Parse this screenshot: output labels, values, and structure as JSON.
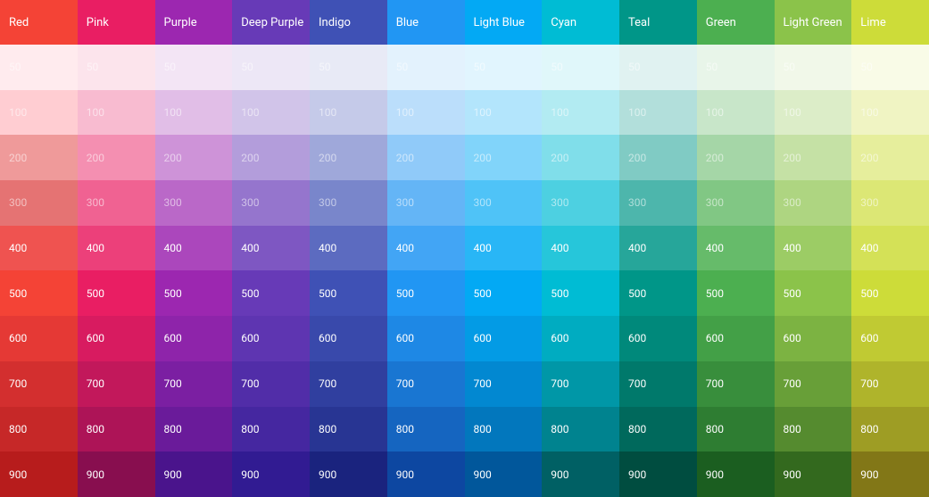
{
  "columns": [
    {
      "name": "Red",
      "header_bg": "#F44336",
      "shades": {
        "50": "#FFEBEE",
        "100": "#FFCDD2",
        "200": "#EF9A9A",
        "300": "#E57373",
        "400": "#EF5350",
        "500": "#F44336",
        "600": "#E53935",
        "700": "#D32F2F",
        "800": "#C62828",
        "900": "#B71C1C"
      }
    },
    {
      "name": "Pink",
      "header_bg": "#E91E63",
      "shades": {
        "50": "#FCE4EC",
        "100": "#F8BBD0",
        "200": "#F48FB1",
        "300": "#F06292",
        "400": "#EC407A",
        "500": "#E91E63",
        "600": "#D81B60",
        "700": "#C2185B",
        "800": "#AD1457",
        "900": "#880E4F"
      }
    },
    {
      "name": "Purple",
      "header_bg": "#9C27B0",
      "shades": {
        "50": "#F3E5F5",
        "100": "#E1BEE7",
        "200": "#CE93D8",
        "300": "#BA68C8",
        "400": "#AB47BC",
        "500": "#9C27B0",
        "600": "#8E24AA",
        "700": "#7B1FA2",
        "800": "#6A1B9A",
        "900": "#4A148C"
      }
    },
    {
      "name": "Deep Purple",
      "header_bg": "#673AB7",
      "shades": {
        "50": "#EDE7F6",
        "100": "#D1C4E9",
        "200": "#B39DDB",
        "300": "#9575CD",
        "400": "#7E57C2",
        "500": "#673AB7",
        "600": "#5E35B1",
        "700": "#512DA8",
        "800": "#4527A0",
        "900": "#311B92"
      }
    },
    {
      "name": "Indigo",
      "header_bg": "#3F51B5",
      "shades": {
        "50": "#E8EAF6",
        "100": "#C5CAE9",
        "200": "#9FA8DA",
        "300": "#7986CB",
        "400": "#5C6BC0",
        "500": "#3F51B5",
        "600": "#3949AB",
        "700": "#303F9F",
        "800": "#283593",
        "900": "#1A237E"
      }
    },
    {
      "name": "Blue",
      "header_bg": "#2196F3",
      "shades": {
        "50": "#E3F2FD",
        "100": "#BBDEFB",
        "200": "#90CAF9",
        "300": "#64B5F6",
        "400": "#42A5F5",
        "500": "#2196F3",
        "600": "#1E88E5",
        "700": "#1976D2",
        "800": "#1565C0",
        "900": "#0D47A1"
      }
    },
    {
      "name": "Light Blue",
      "header_bg": "#03A9F4",
      "shades": {
        "50": "#E1F5FE",
        "100": "#B3E5FC",
        "200": "#81D4FA",
        "300": "#4FC3F7",
        "400": "#29B6F6",
        "500": "#03A9F4",
        "600": "#039BE5",
        "700": "#0288D1",
        "800": "#0277BD",
        "900": "#01579B"
      }
    },
    {
      "name": "Cyan",
      "header_bg": "#00BCD4",
      "shades": {
        "50": "#E0F7FA",
        "100": "#B2EBF2",
        "200": "#80DEEA",
        "300": "#4DD0E1",
        "400": "#26C6DA",
        "500": "#00BCD4",
        "600": "#00ACC1",
        "700": "#0097A7",
        "800": "#00838F",
        "900": "#006064"
      }
    },
    {
      "name": "Teal",
      "header_bg": "#009688",
      "shades": {
        "50": "#E0F2F1",
        "100": "#B2DFDB",
        "200": "#80CBC4",
        "300": "#4DB6AC",
        "400": "#26A69A",
        "500": "#009688",
        "600": "#00897B",
        "700": "#00796B",
        "800": "#00695C",
        "900": "#004D40"
      }
    },
    {
      "name": "Green",
      "header_bg": "#4CAF50",
      "shades": {
        "50": "#E8F5E9",
        "100": "#C8E6C9",
        "200": "#A5D6A7",
        "300": "#81C784",
        "400": "#66BB6A",
        "500": "#4CAF50",
        "600": "#43A047",
        "700": "#388E3C",
        "800": "#2E7D32",
        "900": "#1B5E20"
      }
    },
    {
      "name": "Light Green",
      "header_bg": "#8BC34A",
      "shades": {
        "50": "#F1F8E9",
        "100": "#DCEDC8",
        "200": "#C5E1A5",
        "300": "#AED581",
        "400": "#9CCC65",
        "500": "#8BC34A",
        "600": "#7CB342",
        "700": "#689F38",
        "800": "#558B2F",
        "900": "#33691E"
      }
    },
    {
      "name": "Lime",
      "header_bg": "#CDDC39",
      "shades": {
        "50": "#F9FBE7",
        "100": "#F0F4C3",
        "200": "#E6EE9C",
        "300": "#DCE775",
        "400": "#D4E157",
        "500": "#CDDC39",
        "600": "#C0CA33",
        "700": "#AFB42B",
        "800": "#9E9D24",
        "900": "#827717"
      }
    }
  ],
  "shade_keys": [
    "50",
    "100",
    "200",
    "300",
    "400",
    "500",
    "600",
    "700",
    "800",
    "900"
  ]
}
